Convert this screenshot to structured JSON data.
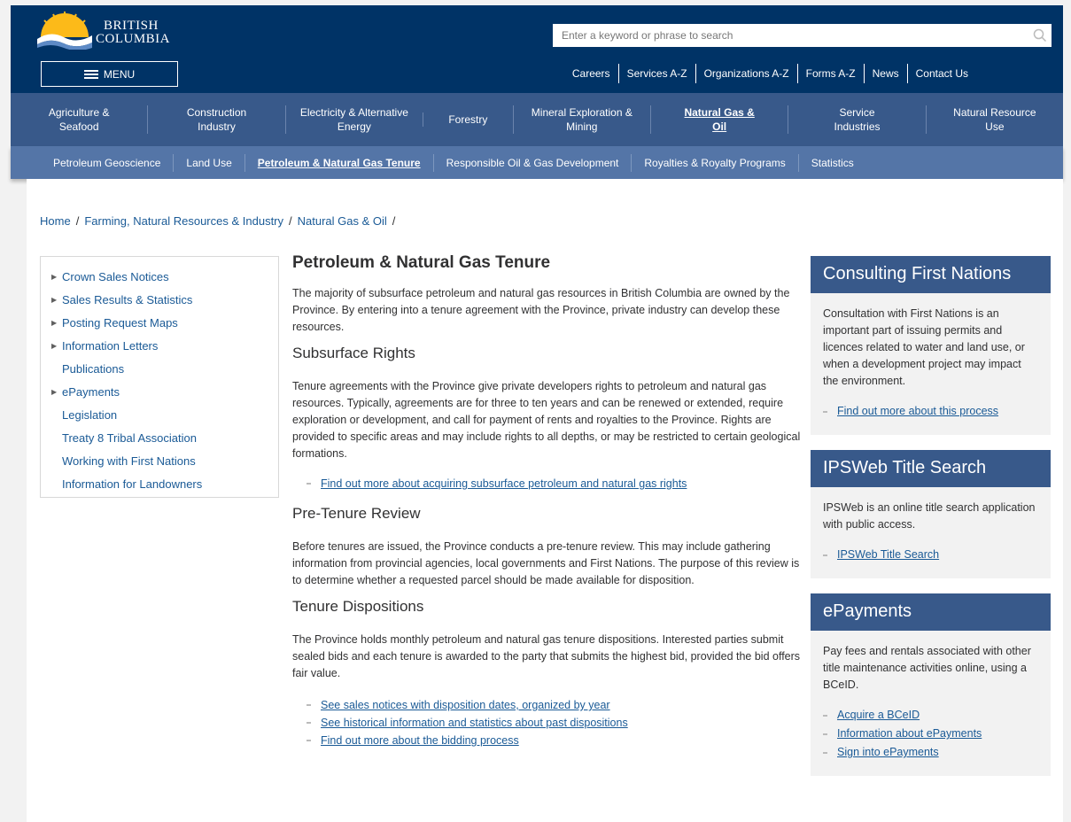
{
  "header": {
    "logo_line1": "BRITISH",
    "logo_line2": "COLUMBIA",
    "menu_label": "MENU",
    "search_placeholder": "Enter a keyword or phrase to search",
    "top_links": [
      "Careers",
      "Services A-Z",
      "Organizations A-Z",
      "Forms A-Z",
      "News",
      "Contact Us"
    ],
    "brand_color": "#003366",
    "sun_color": "#fcba19"
  },
  "primary_nav": [
    {
      "line1": "Agriculture &",
      "line2": "Seafood"
    },
    {
      "line1": "Construction",
      "line2": "Industry"
    },
    {
      "line1": "Electricity & Alternative",
      "line2": "Energy"
    },
    {
      "line1": "Forestry",
      "line2": ""
    },
    {
      "line1": "Mineral Exploration &",
      "line2": "Mining"
    },
    {
      "line1": "Natural Gas &",
      "line2": "Oil"
    },
    {
      "line1": "Service",
      "line2": "Industries"
    },
    {
      "line1": "Natural Resource",
      "line2": "Use"
    }
  ],
  "secondary_nav": [
    "Petroleum Geoscience",
    "Land Use",
    "Petroleum & Natural Gas Tenure",
    "Responsible Oil & Gas Development",
    "Royalties & Royalty Programs",
    "Statistics"
  ],
  "breadcrumb": [
    "Home",
    "Farming, Natural Resources & Industry",
    "Natural Gas & Oil"
  ],
  "sidenav": [
    {
      "label": "Crown Sales Notices",
      "arrow": true
    },
    {
      "label": "Sales Results & Statistics",
      "arrow": true
    },
    {
      "label": "Posting Request Maps",
      "arrow": true
    },
    {
      "label": "Information Letters",
      "arrow": true
    },
    {
      "label": "Publications",
      "arrow": false
    },
    {
      "label": "ePayments",
      "arrow": true
    },
    {
      "label": "Legislation",
      "arrow": false
    },
    {
      "label": "Treaty 8 Tribal Association",
      "arrow": false
    },
    {
      "label": "Working with First Nations",
      "arrow": false
    },
    {
      "label": "Information for Landowners",
      "arrow": false
    }
  ],
  "main": {
    "title": "Petroleum & Natural Gas Tenure",
    "intro": "The majority of subsurface petroleum and natural gas resources in British Columbia are owned by the Province. By entering into a tenure agreement with the Province, private industry can develop these resources.",
    "s1_title": "Subsurface Rights",
    "s1_text": "Tenure agreements with the Province give private developers rights to petroleum and natural gas resources. Typically, agreements are for three to ten years and can be renewed or extended, require exploration or development, and call for payment of rents and royalties to the Province.  Rights are provided to specific areas and may include rights to all depths, or may be restricted to certain geological formations.",
    "s1_link": "Find out more about acquiring subsurface petroleum and natural gas rights",
    "s2_title": "Pre-Tenure Review",
    "s2_text": "Before tenures are issued, the Province conducts a pre-tenure review. This may include gathering information from provincial agencies, local governments and First Nations.  The purpose of this review is to determine whether a requested parcel should be made available for disposition.",
    "s3_title": "Tenure Dispositions",
    "s3_text": "The Province holds monthly petroleum and natural gas tenure dispositions. Interested parties submit sealed bids and each tenure is awarded to the party that submits the highest bid, provided the bid offers fair value.",
    "s3_links": [
      "See sales notices with disposition dates, organized by year",
      "See historical information and statistics about past dispositions",
      "Find out more about the bidding process"
    ]
  },
  "sidebar": {
    "c1_title": "Consulting First Nations",
    "c1_text": "Consultation with First Nations is an important part of issuing permits and licences related to water and land use, or when a development project may impact the environment.",
    "c1_link": "Find out more about this process",
    "c2_title": "IPSWeb Title Search",
    "c2_text": "IPSWeb is an online title search application with public access.",
    "c2_link": "IPSWeb Title Search",
    "c3_title": "ePayments",
    "c3_text": "Pay fees and rentals associated with other title maintenance activities online, using a BCeID.",
    "c3_links": [
      "Acquire a BCeID",
      "Information about ePayments",
      "Sign into ePayments"
    ]
  }
}
